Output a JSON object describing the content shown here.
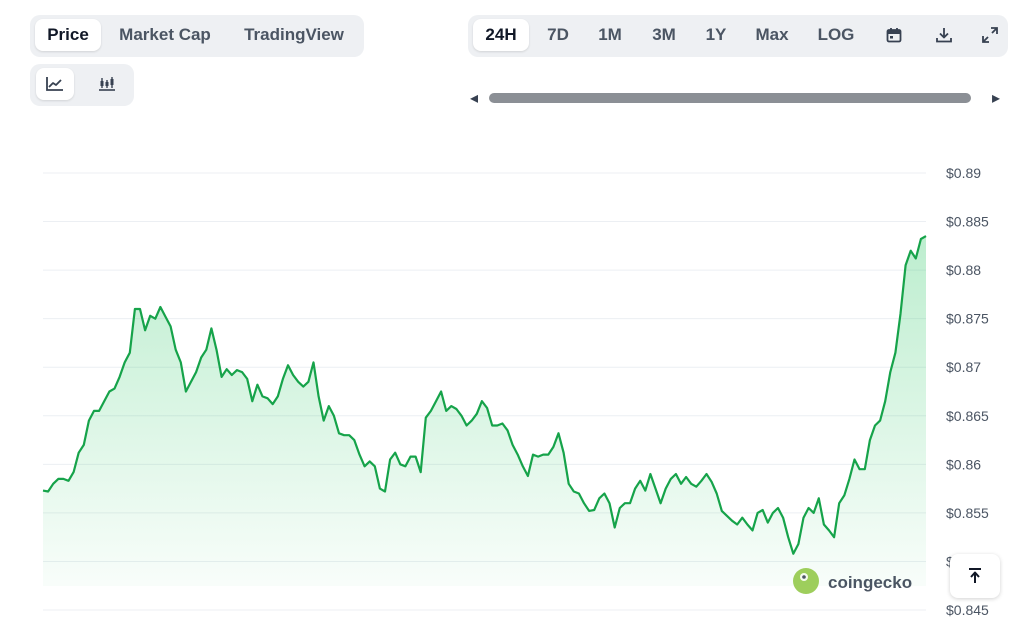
{
  "tabs_left": [
    "Price",
    "Market Cap",
    "TradingView"
  ],
  "active_left_tab": "Price",
  "chart_style_buttons": [
    "line-chart-icon",
    "candlestick-chart-icon"
  ],
  "ranges": [
    "24H",
    "7D",
    "1M",
    "3M",
    "1Y",
    "Max",
    "LOG"
  ],
  "active_range": "24H",
  "toolbar_icons": [
    "calendar-icon",
    "download-icon",
    "fullscreen-icon"
  ],
  "scrollbar": {
    "left_arrow": "◂",
    "right_arrow": "▸"
  },
  "watermark": "coingecko",
  "colors": {
    "line": "#16a34a",
    "fill": "#22c55e",
    "grid": "#eceff3"
  },
  "chart_data": {
    "type": "area",
    "title": "",
    "xlabel": "",
    "ylabel": "",
    "ylim": [
      0.845,
      0.89
    ],
    "yticks": [
      0.845,
      0.85,
      0.855,
      0.86,
      0.865,
      0.87,
      0.875,
      0.88,
      0.885,
      0.89
    ],
    "ytick_labels": [
      "$0.845",
      "$0.85",
      "$0.855",
      "$0.86",
      "$0.865",
      "$0.87",
      "$0.875",
      "$0.88",
      "$0.885",
      "$0.89"
    ],
    "grid": true,
    "series": [
      {
        "values": [
          0.8573,
          0.8572,
          0.858,
          0.8585,
          0.8585,
          0.8583,
          0.8592,
          0.8612,
          0.862,
          0.8645,
          0.8655,
          0.8655,
          0.8665,
          0.8675,
          0.8678,
          0.869,
          0.8705,
          0.8715,
          0.876,
          0.876,
          0.8738,
          0.8753,
          0.875,
          0.8762,
          0.8752,
          0.8742,
          0.8718,
          0.8705,
          0.8675,
          0.8685,
          0.8695,
          0.871,
          0.8718,
          0.874,
          0.8718,
          0.869,
          0.8698,
          0.8692,
          0.8697,
          0.8695,
          0.8688,
          0.8665,
          0.8682,
          0.867,
          0.8668,
          0.8662,
          0.867,
          0.8688,
          0.8702,
          0.8692,
          0.8685,
          0.868,
          0.8685,
          0.8705,
          0.867,
          0.8645,
          0.866,
          0.865,
          0.8632,
          0.863,
          0.863,
          0.8625,
          0.861,
          0.8598,
          0.8603,
          0.8598,
          0.8575,
          0.8572,
          0.8605,
          0.8612,
          0.86,
          0.8598,
          0.8608,
          0.8608,
          0.8592,
          0.8648,
          0.8655,
          0.8665,
          0.8675,
          0.8655,
          0.866,
          0.8657,
          0.865,
          0.864,
          0.8645,
          0.8652,
          0.8665,
          0.8658,
          0.864,
          0.864,
          0.8642,
          0.8635,
          0.862,
          0.861,
          0.8598,
          0.8588,
          0.861,
          0.8608,
          0.861,
          0.861,
          0.8618,
          0.8632,
          0.8612,
          0.858,
          0.8572,
          0.857,
          0.856,
          0.8552,
          0.8553,
          0.8565,
          0.857,
          0.856,
          0.8535,
          0.8555,
          0.856,
          0.856,
          0.8575,
          0.8583,
          0.8573,
          0.859,
          0.8575,
          0.856,
          0.8575,
          0.8585,
          0.859,
          0.858,
          0.8587,
          0.858,
          0.8577,
          0.8583,
          0.859,
          0.8582,
          0.857,
          0.8552,
          0.8547,
          0.8542,
          0.8538,
          0.8545,
          0.8538,
          0.8532,
          0.855,
          0.8553,
          0.854,
          0.855,
          0.8555,
          0.8545,
          0.8525,
          0.8508,
          0.8518,
          0.8545,
          0.8555,
          0.855,
          0.8565,
          0.8538,
          0.8532,
          0.8525,
          0.856,
          0.8568,
          0.8585,
          0.8605,
          0.8595,
          0.8595,
          0.8625,
          0.864,
          0.8645,
          0.8665,
          0.8695,
          0.8715,
          0.8755,
          0.8805,
          0.882,
          0.8812,
          0.8832,
          0.8835
        ]
      }
    ]
  }
}
